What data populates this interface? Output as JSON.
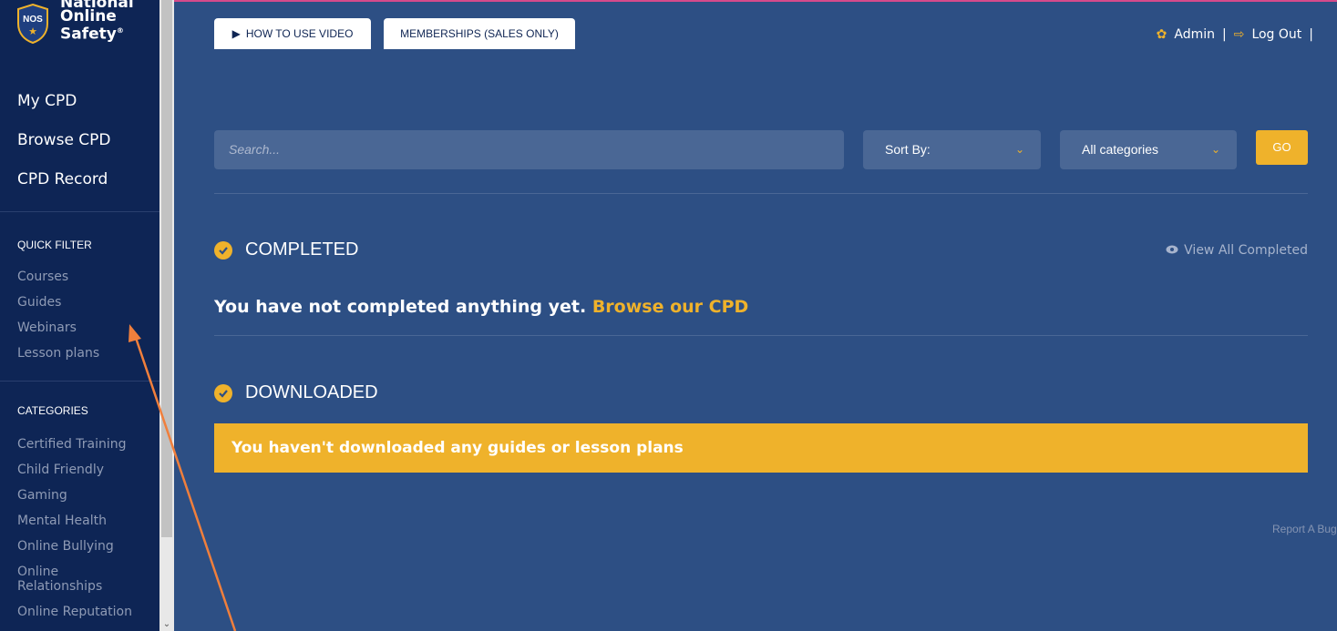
{
  "logo": {
    "line1": "National",
    "line2": "Online",
    "line3": "Safety",
    "shield_text": "NOS"
  },
  "sidebar": {
    "main_nav": [
      {
        "label": "My CPD"
      },
      {
        "label": "Browse CPD"
      },
      {
        "label": "CPD Record"
      }
    ],
    "quick_filter": {
      "title": "QUICK FILTER",
      "items": [
        {
          "label": "Courses"
        },
        {
          "label": "Guides"
        },
        {
          "label": "Webinars"
        },
        {
          "label": "Lesson plans"
        }
      ]
    },
    "categories": {
      "title": "CATEGORIES",
      "items": [
        {
          "label": "Certified Training"
        },
        {
          "label": "Child Friendly"
        },
        {
          "label": "Gaming"
        },
        {
          "label": "Mental Health"
        },
        {
          "label": "Online Bullying"
        },
        {
          "label": "Online Relationships"
        },
        {
          "label": "Online Reputation"
        }
      ]
    }
  },
  "header": {
    "video_button": "HOW TO USE VIDEO",
    "memberships_button": "MEMBERSHIPS (SALES ONLY)",
    "admin_label": "Admin",
    "separator": "|",
    "logout_label": "Log Out"
  },
  "search": {
    "placeholder": "Search...",
    "sort_label": "Sort By:",
    "category_label": "All categories",
    "go_label": "GO"
  },
  "completed": {
    "title": "COMPLETED",
    "view_all": "View All Completed",
    "empty_text": "You have not completed anything yet.",
    "empty_link": "Browse our CPD"
  },
  "downloaded": {
    "title": "DOWNLOADED",
    "empty_text": "You haven't downloaded any guides or lesson plans"
  },
  "footer": {
    "report": "Report A Bug"
  },
  "colors": {
    "accent": "#efb22b",
    "sidebar": "#0e2555",
    "main": "#2d4f84",
    "annotation": "#f07f3c"
  }
}
